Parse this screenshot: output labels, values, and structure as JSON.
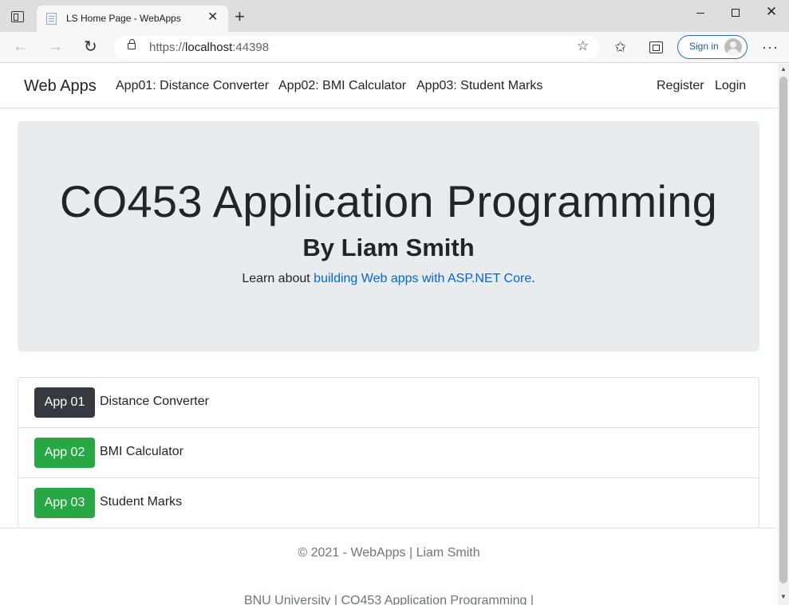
{
  "browser": {
    "tab_title": "LS Home Page - WebApps",
    "url_prefix": "https://",
    "url_host": "localhost",
    "url_port": ":44398",
    "signin_label": "Sign in"
  },
  "site": {
    "brand": "Web Apps",
    "nav": [
      {
        "label": "App01: Distance Converter"
      },
      {
        "label": "App02: BMI Calculator"
      },
      {
        "label": "App03: Student Marks"
      }
    ],
    "register_label": "Register",
    "login_label": "Login"
  },
  "hero": {
    "title": "CO453 Application Programming",
    "subtitle": "By Liam Smith",
    "learn_prefix": "Learn about ",
    "learn_link": "building Web apps with ASP.NET Core",
    "learn_suffix": "."
  },
  "apps": [
    {
      "badge": "App 01",
      "name": "Distance Converter",
      "badge_color": "#343a40"
    },
    {
      "badge": "App 02",
      "name": "BMI Calculator",
      "badge_color": "#28a745"
    },
    {
      "badge": "App 03",
      "name": "Student Marks",
      "badge_color": "#28a745"
    }
  ],
  "footer": {
    "copyright": "© 2021 - WebApps | Liam Smith",
    "line2": "BNU University | CO453 Application Programming |"
  },
  "colors": {
    "link": "#0366d6",
    "jumbotron_bg": "#e9ecef",
    "signin_border": "#1a73c8"
  }
}
